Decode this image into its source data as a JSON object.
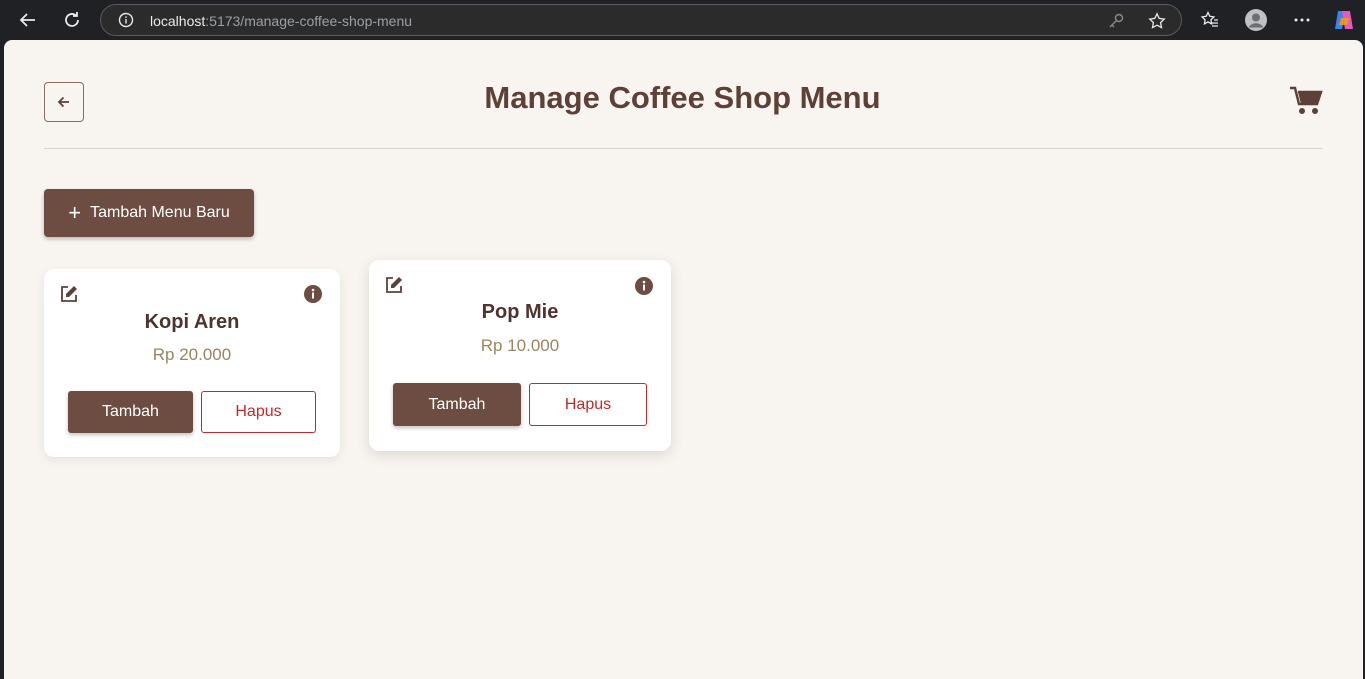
{
  "browser": {
    "url_host": "localhost",
    "url_path": ":5173/manage-coffee-shop-menu"
  },
  "header": {
    "title": "Manage Coffee Shop Menu"
  },
  "toolbar": {
    "add_label": "Tambah Menu Baru"
  },
  "menu": {
    "items": [
      {
        "name": "Kopi Aren",
        "price": "Rp 20.000",
        "add_label": "Tambah",
        "delete_label": "Hapus"
      },
      {
        "name": "Pop Mie",
        "price": "Rp 10.000",
        "add_label": "Tambah",
        "delete_label": "Hapus"
      }
    ]
  },
  "colors": {
    "primary": "#6d4c41",
    "title": "#5d4037",
    "price": "#9a8462",
    "danger": "#c62828",
    "background": "#f8f4ef"
  },
  "icons": [
    "back-arrow-icon",
    "reload-icon",
    "info-icon",
    "cart-icon",
    "edit-icon",
    "plus-icon"
  ]
}
